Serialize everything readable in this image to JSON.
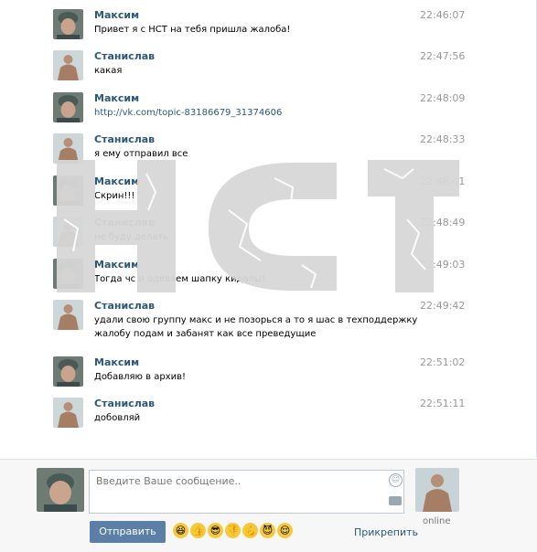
{
  "messages": [
    {
      "author": "Максим",
      "text": "Привет я с НСТ на тебя пришла жалоба!",
      "time": "22:46:07",
      "avatar": "maxim"
    },
    {
      "author": "Станислав",
      "text": "какая",
      "time": "22:47:56",
      "avatar": "stanislav"
    },
    {
      "author": "Максим",
      "text": "http://vk.com/topic-83186679_31374606",
      "time": "22:48:09",
      "avatar": "maxim",
      "link": true
    },
    {
      "author": "Станислав",
      "text": "я ему отправил все",
      "time": "22:48:33",
      "avatar": "stanislav"
    },
    {
      "author": "Максим",
      "text": "Скрин!!!",
      "time": "22:48:41",
      "avatar": "maxim"
    },
    {
      "author": "Станислав",
      "text": "не буду делать",
      "time": "22:48:49",
      "avatar": "stanislav"
    },
    {
      "author": "Максим",
      "text": "Тогда чс и одеваем шапку кидалы!",
      "time": "22:49:03",
      "avatar": "maxim"
    },
    {
      "author": "Станислав",
      "text": "удали свою группу макс и не позорься а то я шас в техподдержку\nжалобу подам и забанят как все преведущие",
      "time": "22:49:42",
      "avatar": "stanislav"
    },
    {
      "author": "Максим",
      "text": "Добавляю в архив!",
      "time": "22:51:02",
      "avatar": "maxim"
    },
    {
      "author": "Станислав",
      "text": "добовляй",
      "time": "22:51:11",
      "avatar": "stanislav"
    }
  ],
  "watermark": "НСТ",
  "composer": {
    "placeholder": "Введите Ваше сообщение..",
    "send_label": "Отправить",
    "attach_label": "Прикрепить",
    "status": "online",
    "emojis": [
      "😆",
      "👍",
      "😎",
      "👎",
      "💪",
      "😈",
      "😌"
    ]
  },
  "colors": {
    "link": "#2b587a",
    "button": "#5b7fa6"
  }
}
